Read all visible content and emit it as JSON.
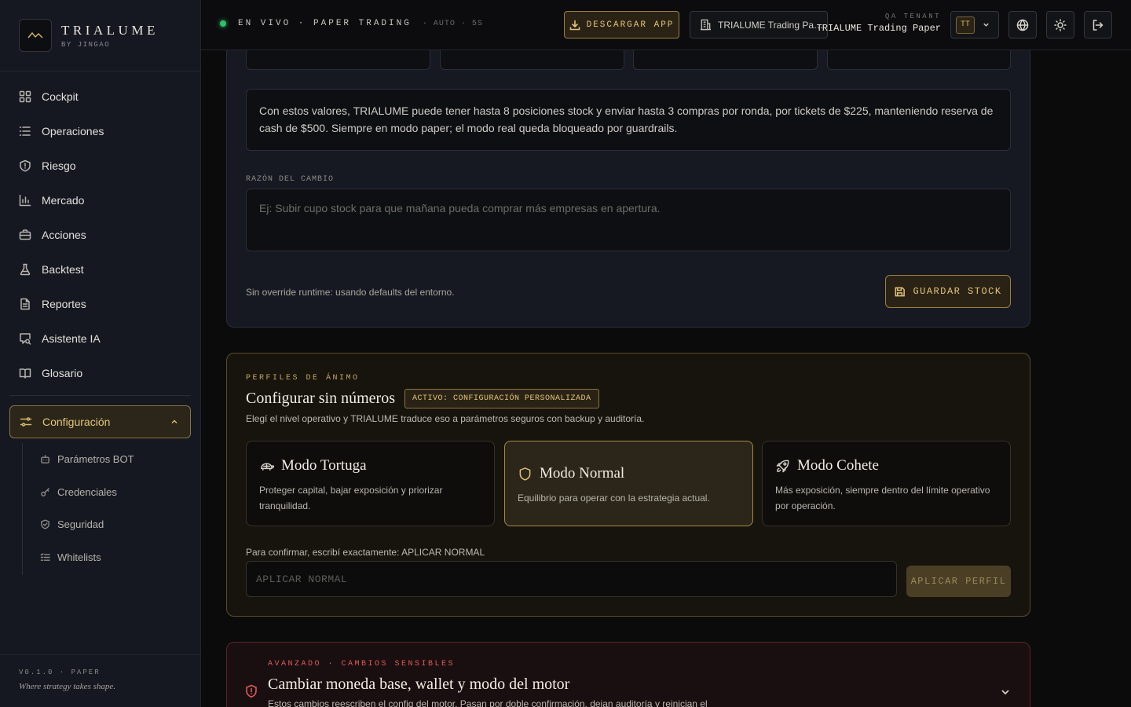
{
  "brand": {
    "name": "TRIALUME",
    "sub": "BY JINGAO"
  },
  "nav": {
    "items": [
      {
        "label": "Cockpit"
      },
      {
        "label": "Operaciones"
      },
      {
        "label": "Riesgo"
      },
      {
        "label": "Mercado"
      },
      {
        "label": "Acciones"
      },
      {
        "label": "Backtest"
      },
      {
        "label": "Reportes"
      },
      {
        "label": "Asistente IA"
      },
      {
        "label": "Glosario"
      }
    ],
    "active": "Configuración",
    "sub": [
      {
        "label": "Parámetros BOT"
      },
      {
        "label": "Credenciales"
      },
      {
        "label": "Seguridad"
      },
      {
        "label": "Whitelists"
      }
    ]
  },
  "footer": {
    "version": "V0.1.0 · PAPER",
    "tagline": "Where strategy takes shape."
  },
  "topbar": {
    "status": "EN VIVO · PAPER TRADING",
    "auto": "· AUTO · 5S",
    "download": "DESCARGAR APP",
    "tenant_btn": "TRIALUME Trading Pa…",
    "qa_label": "QA TENANT",
    "qa_name": "TRIALUME Trading Paper",
    "avatar": "TT"
  },
  "stock": {
    "info": "Con estos valores, TRIALUME puede tener hasta 8 posiciones stock y enviar hasta 3 compras por ronda, por tickets de $225, manteniendo reserva de cash de $500. Siempre en modo paper; el modo real queda bloqueado por guardrails.",
    "reason_label": "RAZÓN DEL CAMBIO",
    "reason_placeholder": "Ej: Subir cupo stock para que mañana pueda comprar más empresas en apertura.",
    "hint": "Sin override runtime: usando defaults del entorno.",
    "save": "GUARDAR STOCK"
  },
  "mood": {
    "kicker": "PERFILES DE ÁNIMO",
    "title": "Configurar sin números",
    "badge": "ACTIVO: CONFIGURACIÓN PERSONALIZADA",
    "subtitle": "Elegí el nivel operativo y TRIALUME traduce eso a parámetros seguros con backup y auditoría.",
    "modes": [
      {
        "name": "Modo Tortuga",
        "desc": "Proteger capital, bajar exposición y priorizar tranquilidad.",
        "icon": "turtle-icon"
      },
      {
        "name": "Modo Normal",
        "desc": "Equilibrio para operar con la estrategia actual.",
        "icon": "shield-icon"
      },
      {
        "name": "Modo Cohete",
        "desc": "Más exposición, siempre dentro del límite operativo por operación.",
        "icon": "rocket-icon"
      }
    ],
    "confirm_label": "Para confirmar, escribí exactamente: APLICAR NORMAL",
    "confirm_placeholder": "APLICAR NORMAL",
    "apply": "APLICAR PERFIL"
  },
  "advanced": {
    "kicker": "AVANZADO · CAMBIOS SENSIBLES",
    "title": "Cambiar moneda base, wallet y modo del motor",
    "subtitle": "Estos cambios reescriben el config del motor. Pasan por doble confirmación, dejan auditoría y reinician el"
  },
  "colors": {
    "accent": "#e2c37a",
    "danger": "#e05a5a",
    "live": "#2fc06a"
  }
}
